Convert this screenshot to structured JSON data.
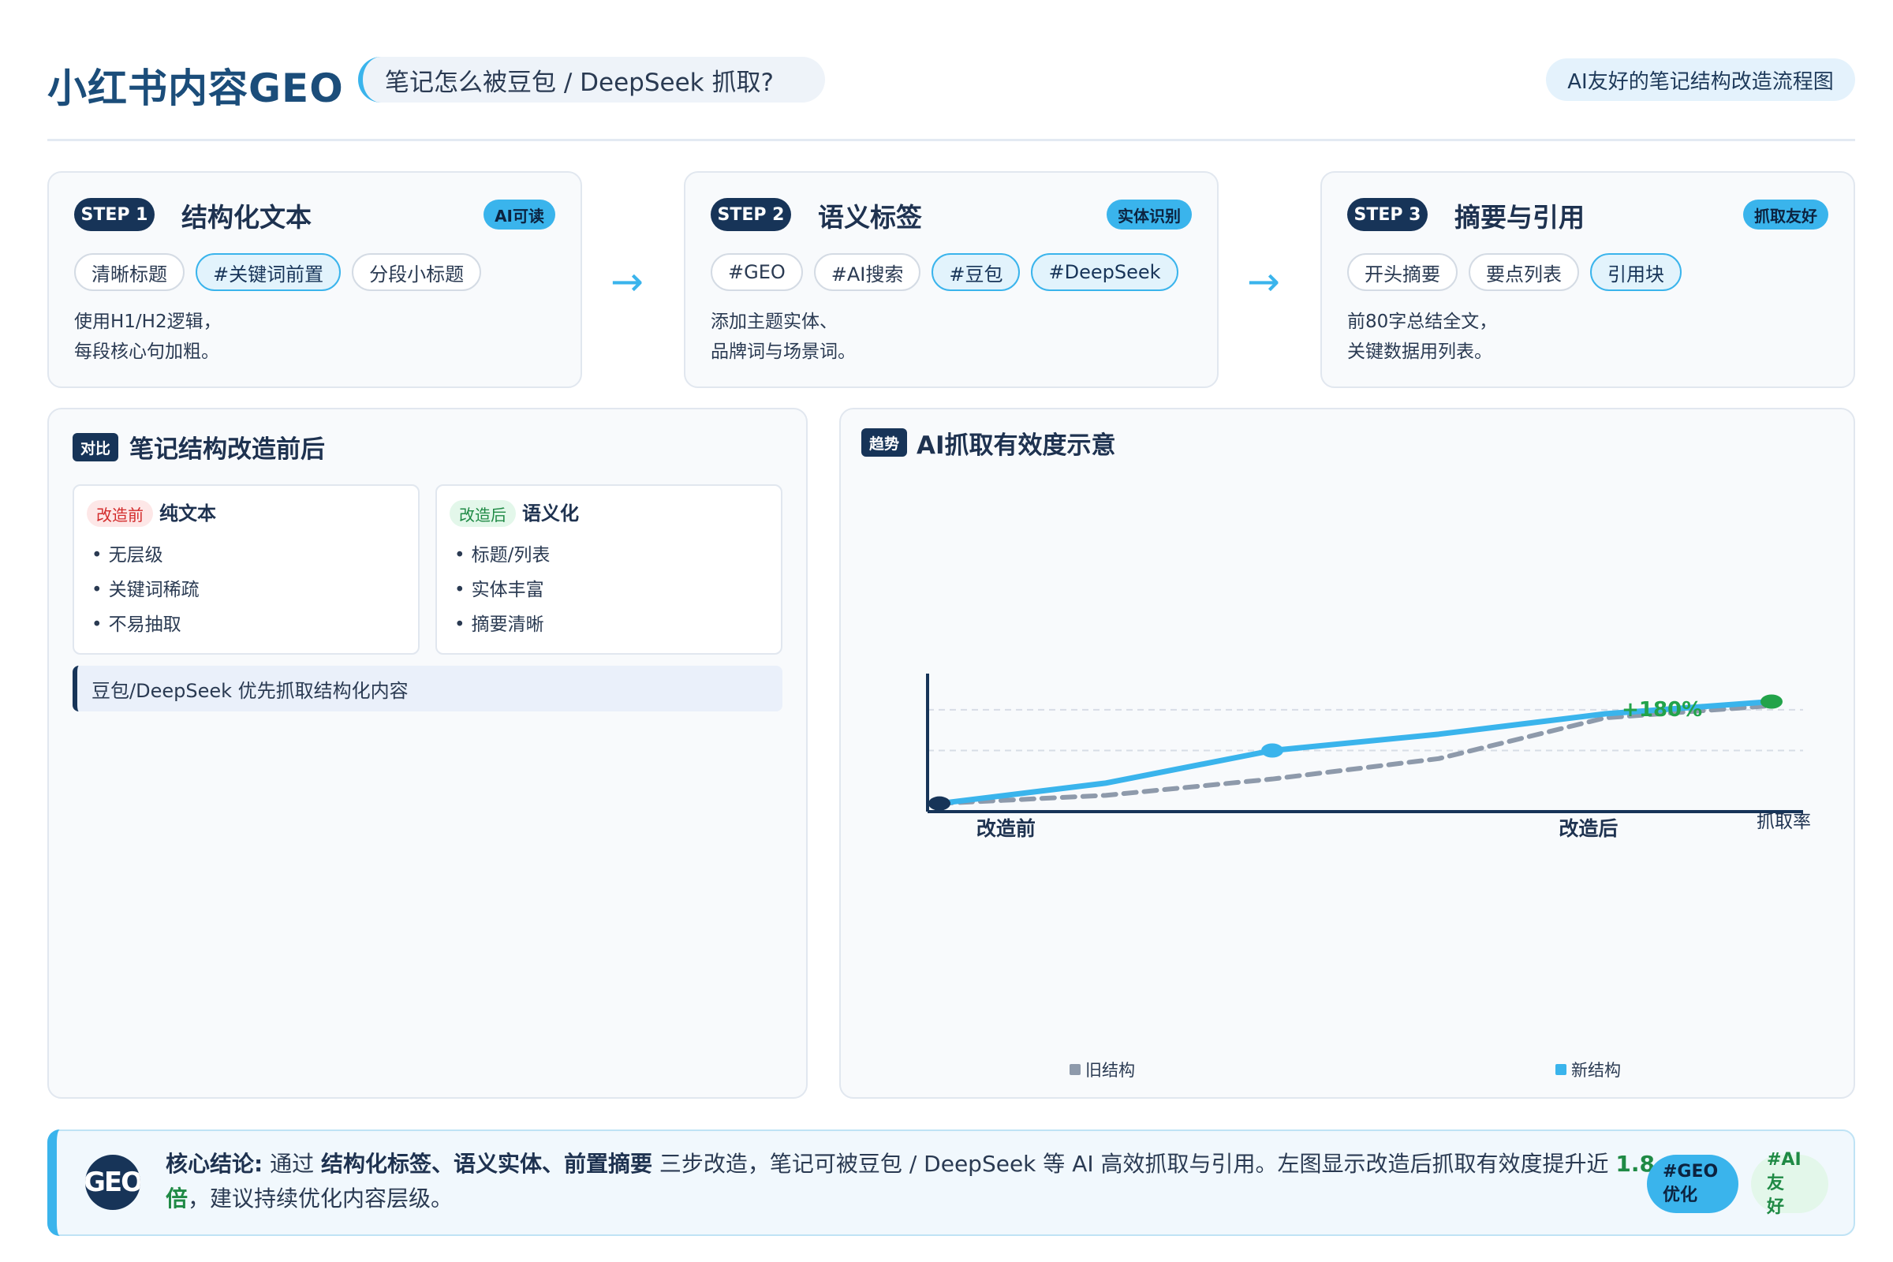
{
  "header": {
    "title": "小红书内容GEO",
    "subtitle": "笔记怎么被豆包 / DeepSeek 抓取?",
    "badge": "AI友好的笔记结构改造流程图"
  },
  "steps": [
    {
      "label": "STEP 1",
      "title": "结构化文本",
      "badge": "AI可读",
      "chips": [
        {
          "text": "清晰标题",
          "highlight": false
        },
        {
          "text": "#关键词前置",
          "highlight": true
        },
        {
          "text": "分段小标题",
          "highlight": false
        }
      ],
      "desc": [
        "使用H1/H2逻辑，",
        "每段核心句加粗。"
      ]
    },
    {
      "label": "STEP 2",
      "title": "语义标签",
      "badge": "实体识别",
      "chips": [
        {
          "text": "#GEO",
          "highlight": false
        },
        {
          "text": "#AI搜索",
          "highlight": false
        },
        {
          "text": "#豆包",
          "highlight": true
        },
        {
          "text": "#DeepSeek",
          "highlight": true
        }
      ],
      "desc": [
        "添加主题实体、",
        "品牌词与场景词。"
      ]
    },
    {
      "label": "STEP 3",
      "title": "摘要与引用",
      "badge": "抓取友好",
      "chips": [
        {
          "text": "开头摘要",
          "highlight": false
        },
        {
          "text": "要点列表",
          "highlight": false
        },
        {
          "text": "引用块",
          "highlight": true
        }
      ],
      "desc": [
        "前80字总结全文，",
        "关键数据用列表。"
      ]
    }
  ],
  "arrows": [
    "→",
    "→"
  ],
  "compare": {
    "tag": "对比",
    "title": "笔记结构改造前后",
    "before": {
      "tag": "改造前",
      "title": "纯文本",
      "items": [
        "无层级",
        "关键词稀疏",
        "不易抽取"
      ]
    },
    "after": {
      "tag": "改造后",
      "title": "语义化",
      "items": [
        "标题/列表",
        "实体丰富",
        "摘要清晰"
      ]
    },
    "note": "豆包/DeepSeek 优先抓取结构化内容"
  },
  "chart": {
    "tag": "趋势",
    "title": "AI抓取有效度示意"
  },
  "chart_data": {
    "type": "line",
    "title": "AI抓取有效度示意",
    "xlabel": "",
    "ylabel": "抓取率",
    "x_tick_labels": [
      "改造前",
      "改造后"
    ],
    "x": [
      0,
      1,
      2,
      3,
      4,
      5
    ],
    "ylim": [
      0,
      3
    ],
    "grid": true,
    "legend_placement": "bottom",
    "annotation": "+180%",
    "series": [
      {
        "name": "旧结构",
        "color": "#8e9aab",
        "style": "dashed",
        "values": [
          0.2,
          0.4,
          0.8,
          1.3,
          2.3,
          2.6
        ]
      },
      {
        "name": "新结构",
        "color": "#3ab4ec",
        "style": "solid",
        "values": [
          0.2,
          0.7,
          1.5,
          1.9,
          2.4,
          2.7
        ]
      }
    ],
    "markers": [
      {
        "series": 1,
        "index": 0,
        "color": "#173458"
      },
      {
        "series": 1,
        "index": 2,
        "color": "#3ab4ec"
      },
      {
        "series": 1,
        "index": 5,
        "color": "#22a34a"
      }
    ]
  },
  "conclusion": {
    "logo": "GEO",
    "lead": "核心结论:",
    "t1": " 通过 ",
    "b1": "结构化标签、语义实体、前置摘要",
    "t2": " 三步改造，笔记可被豆包 / DeepSeek 等 AI 高效抓取与引用。左图显示改造后抓取有效度提升近 ",
    "green": "1.8 倍",
    "t3": "，建议持续优化内容层级。",
    "tags": [
      {
        "line1": "#GEO",
        "line2": "优化"
      },
      {
        "line1": "#AI友",
        "line2": "好"
      }
    ]
  },
  "colors": {
    "navy": "#173458",
    "accent": "#3ab4ec",
    "green": "#1f8a45",
    "red": "#d32b2b"
  }
}
